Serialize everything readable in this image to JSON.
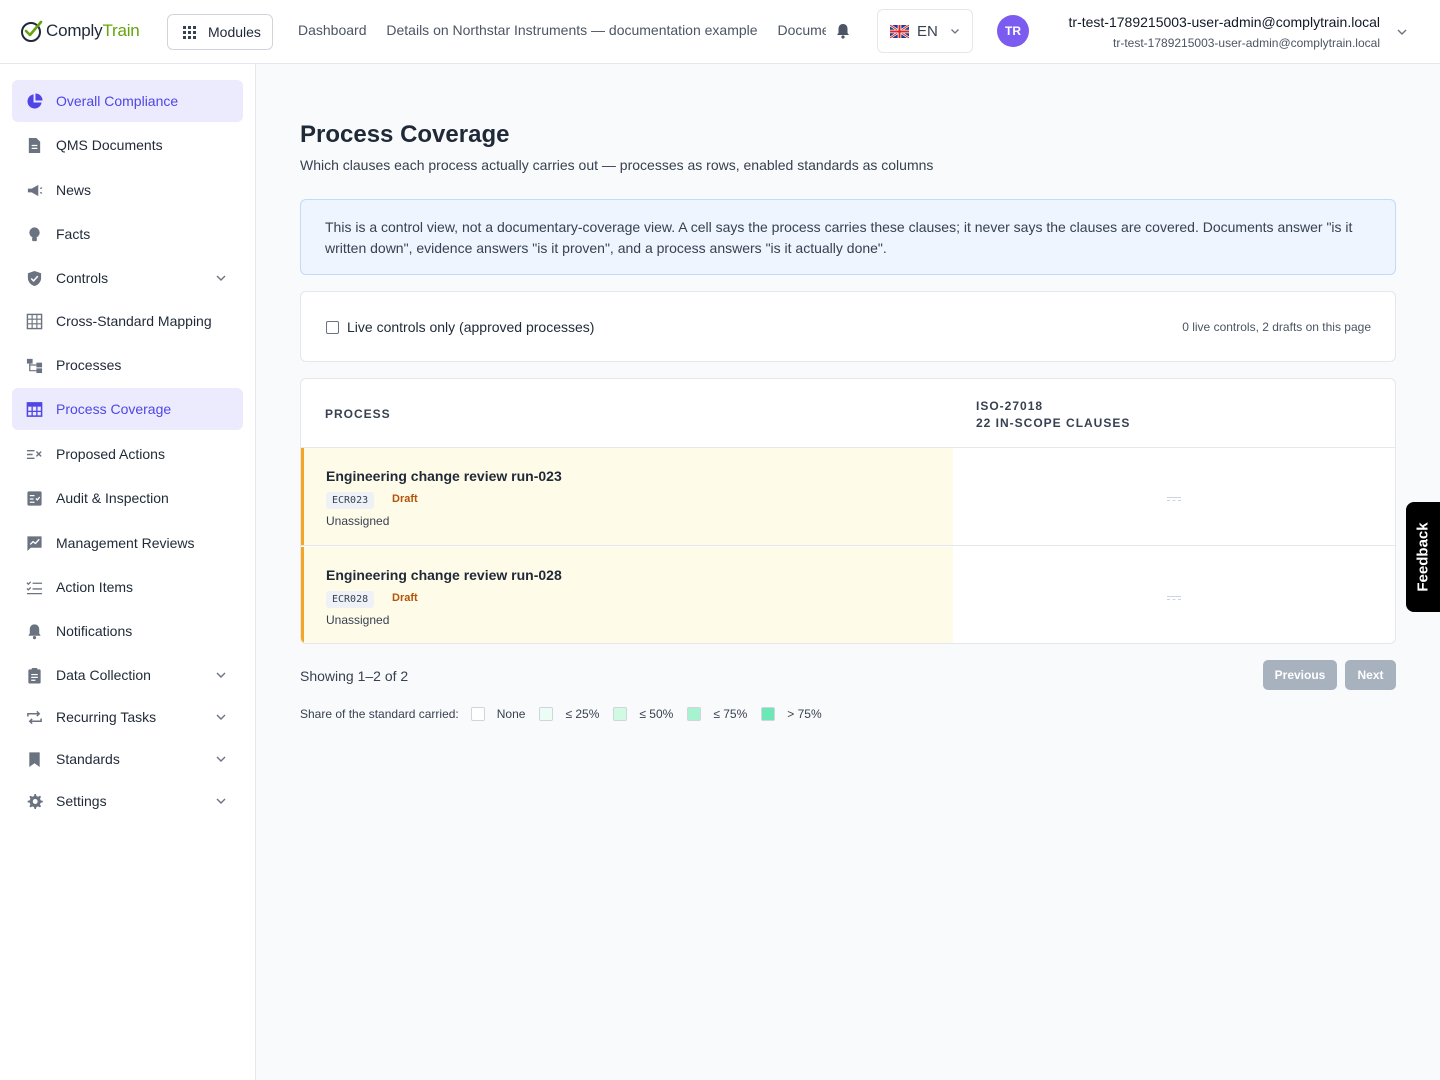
{
  "brand": {
    "name_part1": "Comply",
    "name_part2": "Train",
    "accent_color": "#65a30d"
  },
  "header": {
    "modules_label": "Modules",
    "nav_links": [
      "Dashboard",
      "Details on Northstar Instruments — documentation example",
      "Documents"
    ],
    "language": "EN",
    "avatar_initials": "TR",
    "user_name": "tr-test-1789215003-user-admin@complytrain.local",
    "user_email": "tr-test-1789215003-user-admin@complytrain.local"
  },
  "sidebar": {
    "items": [
      {
        "label": "Overall Compliance",
        "icon": "pie-chart-icon",
        "active": true
      },
      {
        "label": "QMS Documents",
        "icon": "document-icon"
      },
      {
        "label": "News",
        "icon": "megaphone-icon"
      },
      {
        "label": "Facts",
        "icon": "lightbulb-icon"
      },
      {
        "label": "Controls",
        "icon": "shield-check-icon",
        "expandable": true
      },
      {
        "label": "Cross-Standard Mapping",
        "icon": "table-grid-icon"
      },
      {
        "label": "Processes",
        "icon": "flow-icon"
      },
      {
        "label": "Process Coverage",
        "icon": "coverage-table-icon",
        "active": true
      },
      {
        "label": "Proposed Actions",
        "icon": "list-x-icon"
      },
      {
        "label": "Audit & Inspection",
        "icon": "clipboard-check-icon"
      },
      {
        "label": "Management Reviews",
        "icon": "chart-review-icon"
      },
      {
        "label": "Action Items",
        "icon": "checklist-icon"
      },
      {
        "label": "Notifications",
        "icon": "bell-icon"
      },
      {
        "label": "Data Collection",
        "icon": "clipboard-icon",
        "expandable": true
      },
      {
        "label": "Recurring Tasks",
        "icon": "repeat-icon",
        "expandable": true
      },
      {
        "label": "Standards",
        "icon": "bookmark-icon",
        "expandable": true
      },
      {
        "label": "Settings",
        "icon": "gear-icon",
        "expandable": true
      }
    ]
  },
  "page": {
    "title": "Process Coverage",
    "subtitle": "Which clauses each process actually carries out — processes as rows, enabled standards as columns",
    "info": "This is a control view, not a documentary-coverage view. A cell says the process carries these clauses; it never says the clauses are covered. Documents answer \"is it written down\", evidence answers \"is it proven\", and a process answers \"is it actually done\"."
  },
  "filter": {
    "checkbox_label": "Live controls only (approved processes)",
    "checked": false,
    "count_text": "0 live controls, 2 drafts on this page"
  },
  "table": {
    "col_process": "PROCESS",
    "col_standard": "ISO-27018",
    "col_standard_sub": "22 IN-SCOPE CLAUSES",
    "rows": [
      {
        "name": "Engineering change review run-023",
        "code": "ECR023",
        "status": "Draft",
        "owner": "Unassigned"
      },
      {
        "name": "Engineering change review run-028",
        "code": "ECR028",
        "status": "Draft",
        "owner": "Unassigned"
      }
    ]
  },
  "pagination": {
    "showing": "Showing 1–2 of 2",
    "previous": "Previous",
    "next": "Next"
  },
  "legend": {
    "label": "Share of the standard carried:",
    "items": [
      {
        "label": "None",
        "color": "#ffffff"
      },
      {
        "label": "≤ 25%",
        "color": "#ecfdf5"
      },
      {
        "label": "≤ 50%",
        "color": "#d1fae5"
      },
      {
        "label": "≤ 75%",
        "color": "#a7f3d0"
      },
      {
        "label": "> 75%",
        "color": "#6ee7b7"
      }
    ]
  },
  "feedback_label": "Feedback"
}
